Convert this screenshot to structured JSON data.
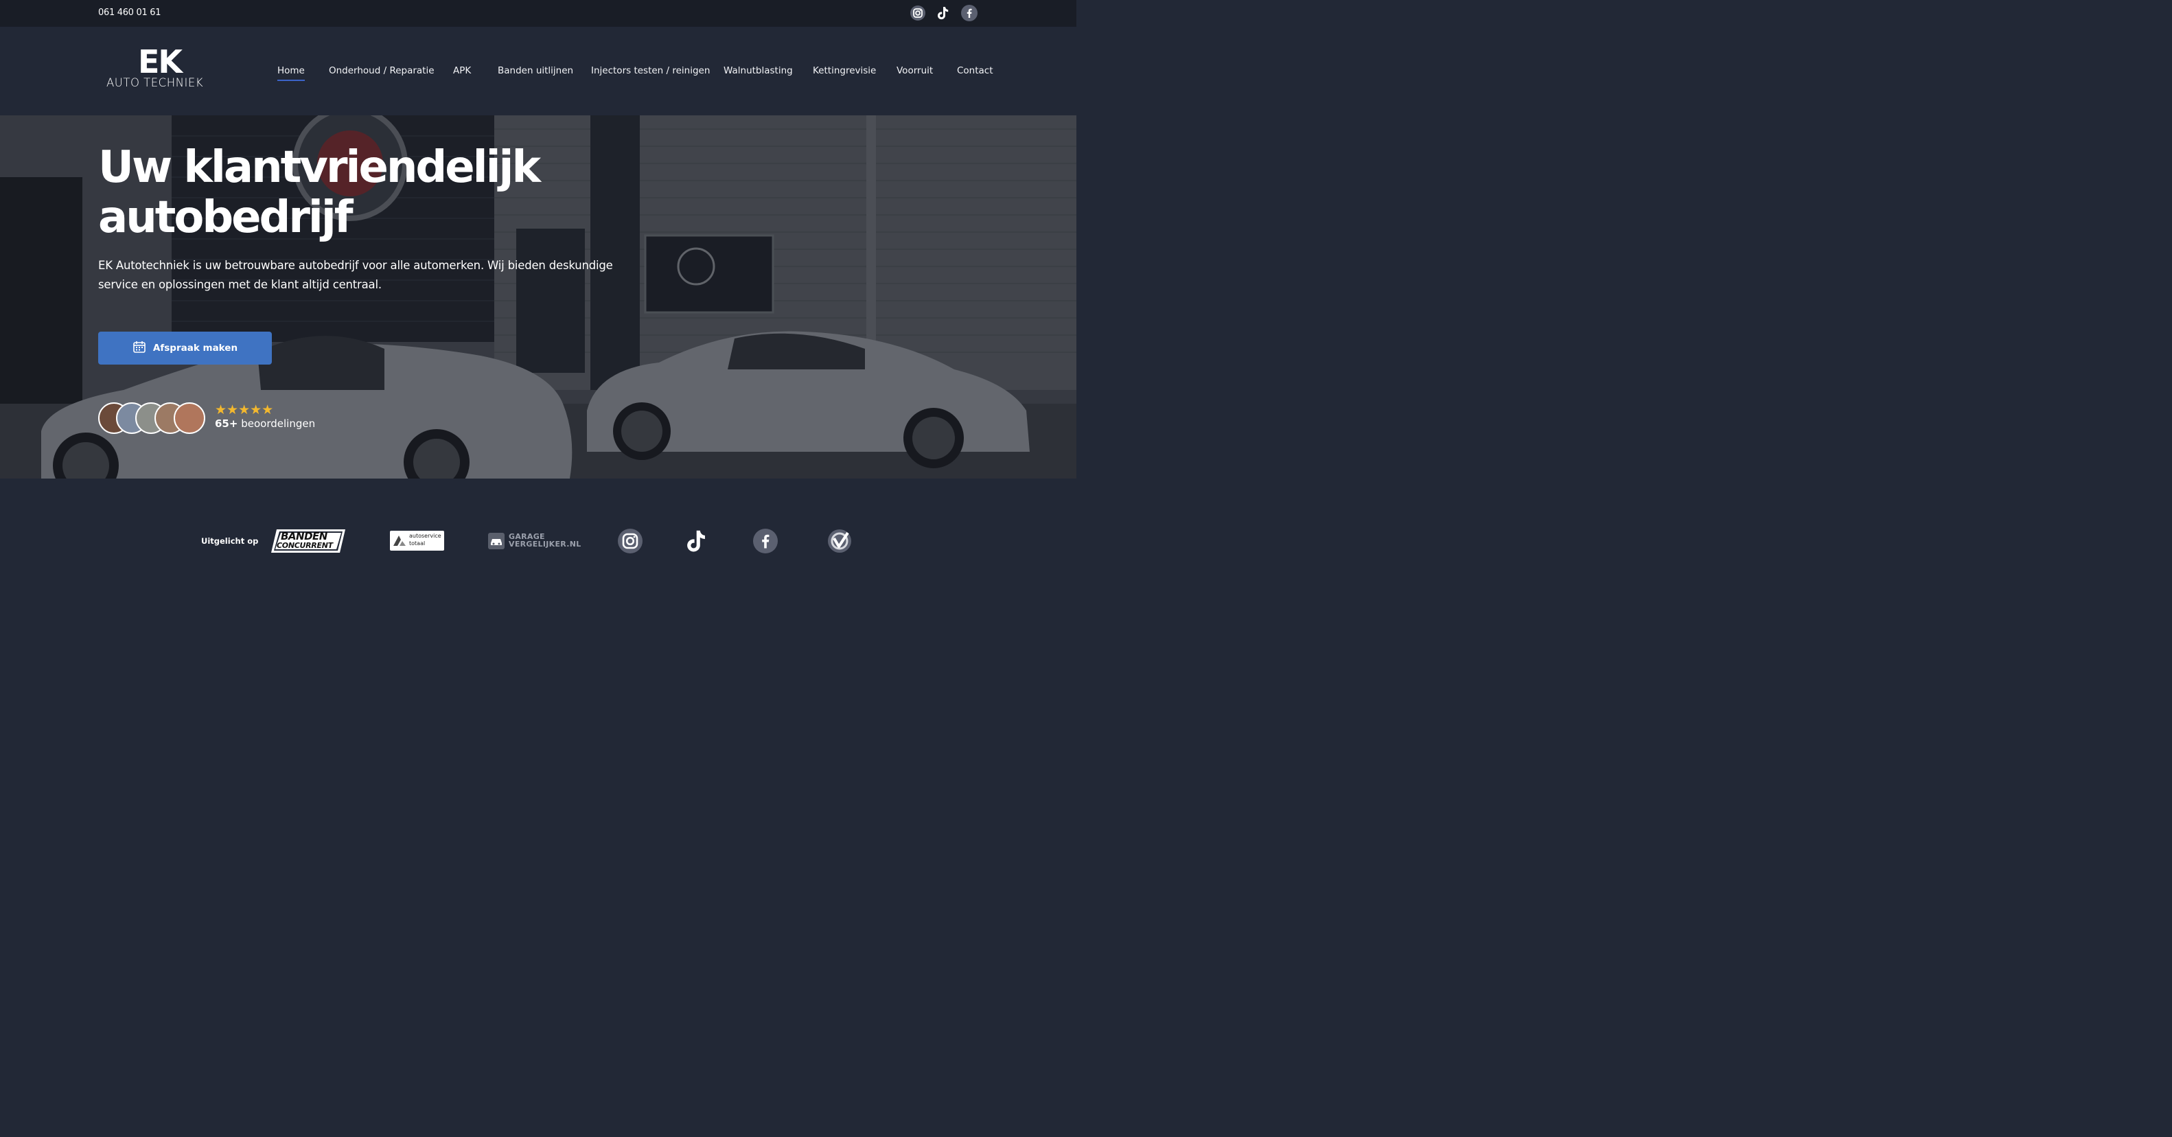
{
  "topbar": {
    "phone": "061 460 01 61",
    "social_icons": [
      "instagram-icon",
      "tiktok-icon",
      "facebook-icon"
    ]
  },
  "header": {
    "logo": {
      "main": "EK",
      "sub": "AUTO TECHNIEK"
    },
    "nav": [
      {
        "label": "Home",
        "active": true
      },
      {
        "label": "Onderhoud / Reparatie",
        "active": false
      },
      {
        "label": "APK",
        "active": false
      },
      {
        "label": "Banden uitlijnen",
        "active": false
      },
      {
        "label": "Injectors testen / reinigen",
        "active": false
      },
      {
        "label": "Walnutblasting",
        "active": false
      },
      {
        "label": "Kettingrevisie",
        "active": false
      },
      {
        "label": "Voorruit",
        "active": false
      },
      {
        "label": "Contact",
        "active": false
      }
    ]
  },
  "hero": {
    "title_line1": "Uw klantvriendelijk",
    "title_line2": "autobedrijf",
    "text": "EK Autotechniek is uw betrouwbare autobedrijf voor alle automerken. Wij bieden deskundige service en oplossingen met de klant altijd centraal.",
    "cta_label": "Afspraak maken",
    "cta_icon": "calendar-icon",
    "rating_stars": 5,
    "stars": "★★★★★",
    "reviews_count": "65+",
    "reviews_label": "beoordelingen"
  },
  "featured": {
    "label": "Uitgelicht op",
    "logos": [
      {
        "name": "banden-concurrent-logo",
        "line1": "BANDEN",
        "line2": "CONCURRENT"
      },
      {
        "name": "autoservice-totaal-logo",
        "line1": "autoservice",
        "line2": "totaal"
      },
      {
        "name": "garage-vergelijker-logo",
        "line1": "GARAGE",
        "line2": "VERGELIJKER.NL"
      },
      {
        "name": "instagram-icon"
      },
      {
        "name": "tiktok-icon"
      },
      {
        "name": "facebook-icon"
      },
      {
        "name": "verified-icon"
      }
    ]
  },
  "colors": {
    "background": "#222836",
    "topbar": "#191d26",
    "accent": "#3f73c2",
    "star": "#f3b82e"
  }
}
